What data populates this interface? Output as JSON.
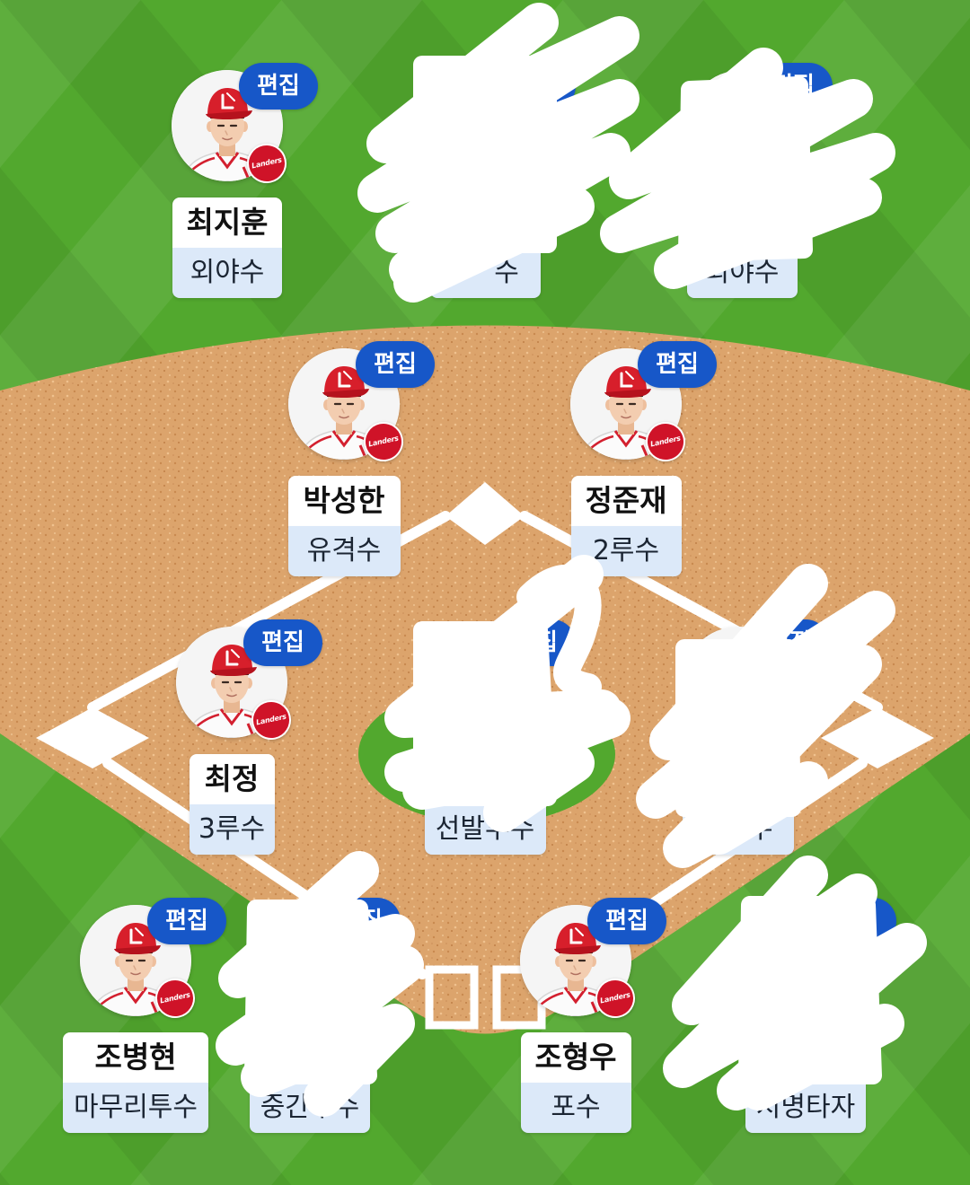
{
  "edit_label": "편집",
  "team_logo_text": "Landers",
  "colors": {
    "edit_badge": "#1757c8",
    "grass": "#52a82e",
    "dirt": "#dca46c",
    "name_bg": "#ffffff",
    "position_bg": "#dce9f9",
    "team_red": "#cf1328",
    "scribble": "#ffffff"
  },
  "players": [
    {
      "name": "최지훈",
      "position": "외야수"
    },
    {
      "position": "수"
    },
    {
      "position": "외야수"
    },
    {
      "name": "박성한",
      "position": "유격수"
    },
    {
      "name": "정준재",
      "position": "2루수"
    },
    {
      "name": "최정",
      "position": "3루수"
    },
    {
      "position": "선발투수"
    },
    {
      "position": "루수"
    },
    {
      "name": "조병현",
      "position": "마무리투수"
    },
    {
      "position": "중간투수"
    },
    {
      "name": "조형우",
      "position": "포수"
    },
    {
      "position": "지명타자"
    }
  ]
}
